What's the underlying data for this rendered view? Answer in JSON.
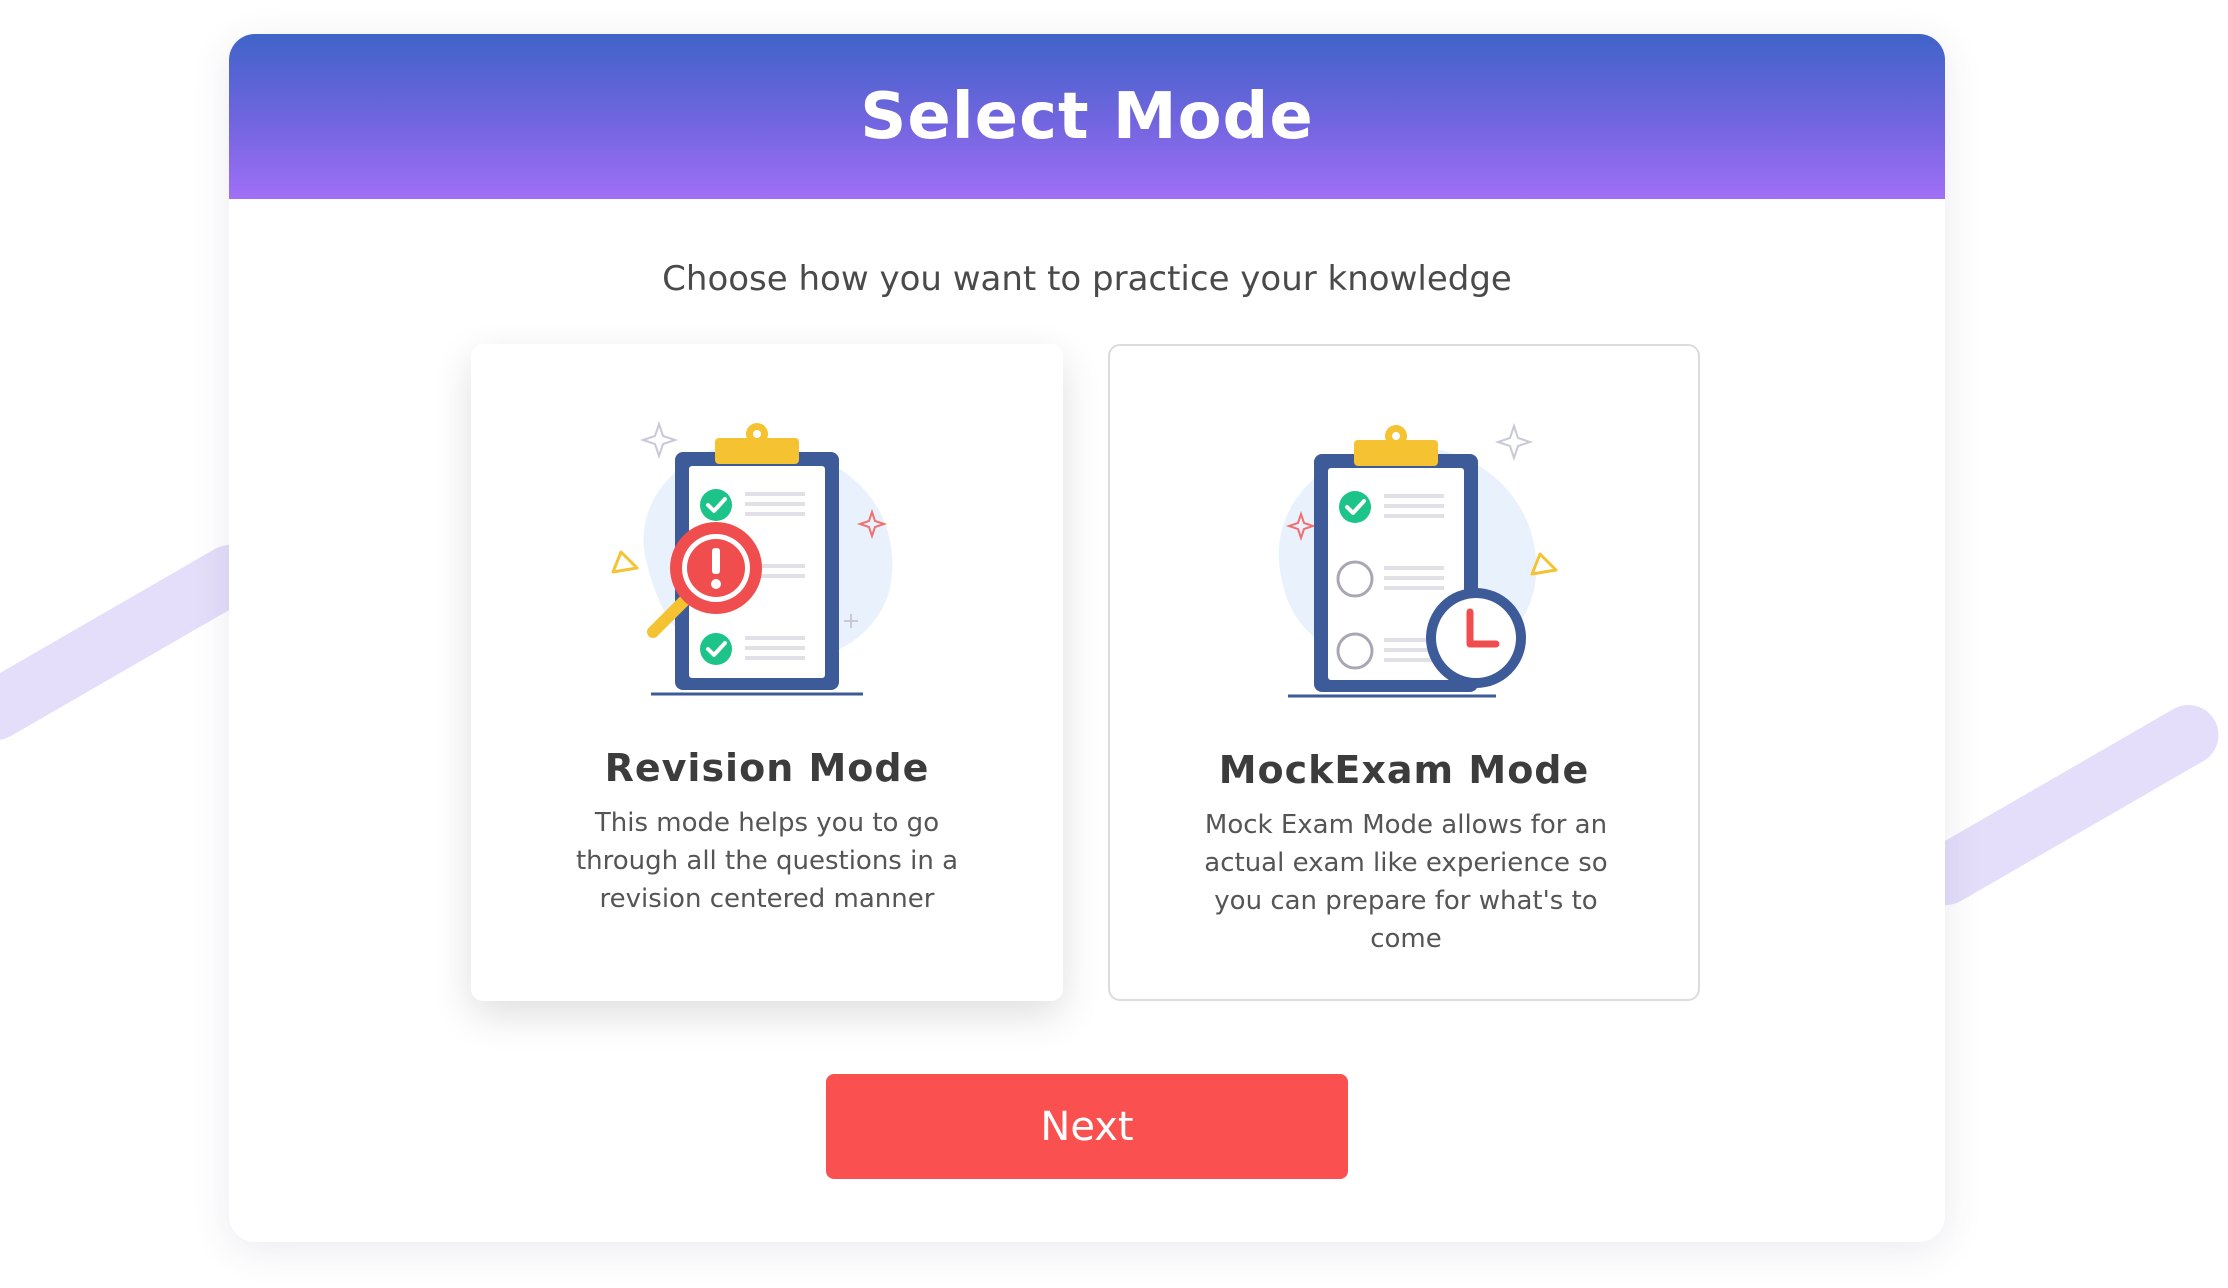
{
  "header": {
    "title": "Select Mode"
  },
  "subtitle": "Choose how you want to practice your knowledge",
  "modes": [
    {
      "title": "Revision Mode",
      "description": "This mode helps you to go through all the questions in a revision centered manner",
      "icon": "clipboard-magnifier-icon",
      "selected": true
    },
    {
      "title": "MockExam Mode",
      "description": "Mock Exam Mode allows for an actual exam like experience so you can prepare for what's to come",
      "icon": "clipboard-clock-icon",
      "selected": false
    }
  ],
  "actions": {
    "next_label": "Next"
  },
  "colors": {
    "header_top": "#3f64c8",
    "header_bottom": "#a070f5",
    "primary_button": "#fa5150",
    "check_green": "#1dc48a",
    "clipboard_blue": "#3d5a99",
    "clip_yellow": "#f5c231",
    "alert_red": "#f04e4e",
    "decor_stripe": "#e4defa"
  }
}
